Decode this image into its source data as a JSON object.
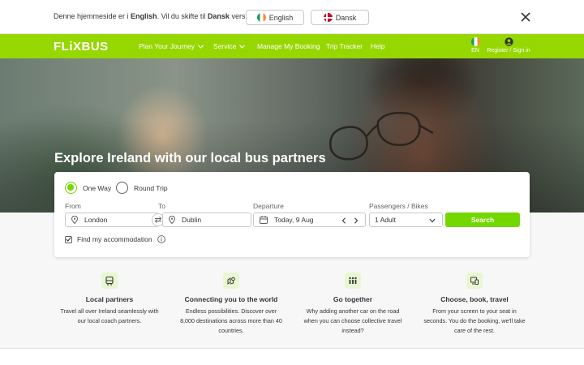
{
  "language_banner": {
    "prefix": "Denne hjemmeside er i ",
    "current_language": "English",
    "middle": ". Vil du skifte til ",
    "target_language": "Dansk",
    "suffix": " versionen?",
    "english_button": "English",
    "danish_button": "Dansk",
    "close_icon": "close-icon"
  },
  "nav": {
    "logo": "FLiXBUS",
    "items": [
      "Plan Your Journey",
      "Service",
      "Manage My Booking",
      "Trip Tracker",
      "Help"
    ],
    "language_code": "EN",
    "account_label": "Register / Sign in"
  },
  "hero": {
    "title": "Explore Ireland with our local bus partners"
  },
  "search": {
    "trip_types": [
      "One Way",
      "Round Trip"
    ],
    "selected_trip_type": "One Way",
    "from_label": "From",
    "from_value": "London",
    "to_label": "To",
    "to_value": "Dublin",
    "departure_label": "Departure",
    "departure_value": "Today, 9 Aug",
    "passengers_label": "Passengers / Bikes",
    "passengers_value": "1 Adult",
    "search_button": "Search",
    "accommodation_label": "Find my accommodation",
    "accommodation_checked": true
  },
  "features": [
    {
      "icon": "bus-icon",
      "title": "Local partners",
      "lines": [
        "Travel all over Ireland seamlessly with",
        "our local coach partners."
      ]
    },
    {
      "icon": "map-route-icon",
      "title": "Connecting you to the world",
      "lines": [
        "Endless possibilities. Discover over",
        "8,000 destinations across more than 40",
        "countries."
      ]
    },
    {
      "icon": "people-icon",
      "title": "Go together",
      "lines": [
        "Why adding another car on the road",
        "when you can choose collective travel",
        "instead?"
      ]
    },
    {
      "icon": "devices-icon",
      "title": "Choose, book, travel",
      "lines": [
        "From your screen to your seat in",
        "seconds. You do the booking, we'll take",
        "care of the rest."
      ]
    }
  ],
  "colors": {
    "brand_green": "#97d700",
    "button_green": "#73d700",
    "text": "#353535"
  }
}
